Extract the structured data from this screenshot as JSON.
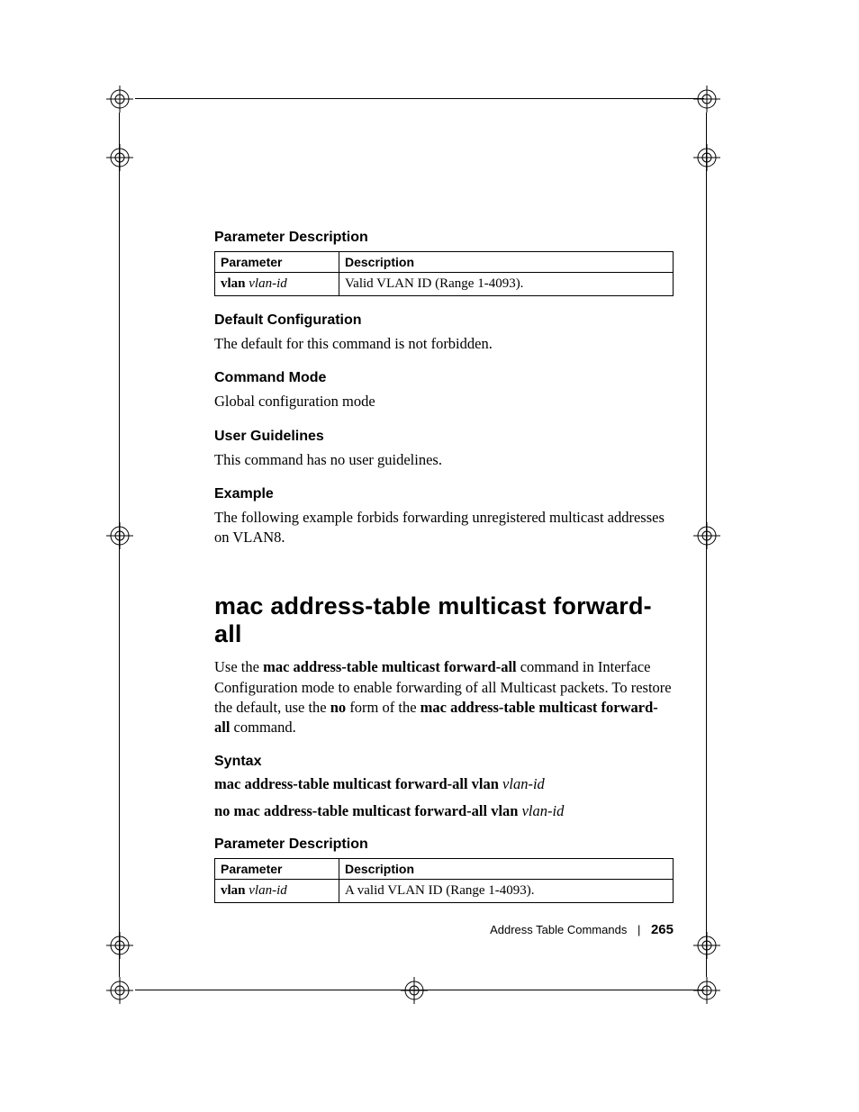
{
  "sec1": {
    "head": "Parameter Description",
    "th1": "Parameter",
    "th2": "Description",
    "p_bold": "vlan ",
    "p_ital": "vlan-id",
    "desc": "Valid VLAN ID (Range 1-4093)."
  },
  "sec2": {
    "head": "Default Configuration",
    "body": "The default for this command is not forbidden."
  },
  "sec3": {
    "head": "Command Mode",
    "body": "Global configuration mode"
  },
  "sec4": {
    "head": "User Guidelines",
    "body": "This command has no user guidelines."
  },
  "sec5": {
    "head": "Example",
    "body": "The following example forbids forwarding unregistered multicast addresses on VLAN8."
  },
  "cmd": {
    "title": "mac address-table multicast forward-all",
    "intro_a": "Use the ",
    "intro_b": "mac address-table multicast forward-all",
    "intro_c": " command in Interface Configuration mode to enable forwarding of all Multicast packets. To restore the default, use the ",
    "intro_d": "no",
    "intro_e": " form of the ",
    "intro_f": "mac address-table multicast forward-all",
    "intro_g": " command."
  },
  "syntax": {
    "head": "Syntax",
    "l1a": "mac address-table multicast forward-all vlan ",
    "l1b": "vlan-id",
    "l2a": "no mac address-table multicast forward-all vlan ",
    "l2b": "vlan-id"
  },
  "sec6": {
    "head": "Parameter Description",
    "th1": "Parameter",
    "th2": "Description",
    "p_bold": "vlan ",
    "p_ital": "vlan-id",
    "desc": "A valid VLAN ID (Range 1-4093)."
  },
  "footer": {
    "section": "Address Table Commands",
    "page": "265"
  }
}
